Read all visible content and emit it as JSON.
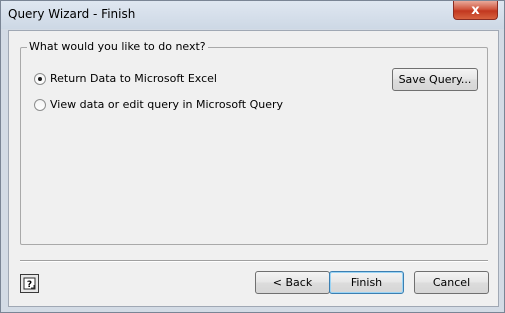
{
  "window": {
    "title": "Query Wizard - Finish",
    "close_glyph": "x"
  },
  "group": {
    "legend": "What would you like to do next?"
  },
  "options": [
    {
      "label": "Return Data to Microsoft Excel",
      "selected": true
    },
    {
      "label": "View data or edit query in Microsoft Query",
      "selected": false
    }
  ],
  "buttons": {
    "save_query": "Save Query...",
    "back": "< Back",
    "finish": "Finish",
    "cancel": "Cancel"
  },
  "icons": {
    "help": "help-icon",
    "close": "close-icon",
    "radio_selected": "radio-dot-icon"
  }
}
